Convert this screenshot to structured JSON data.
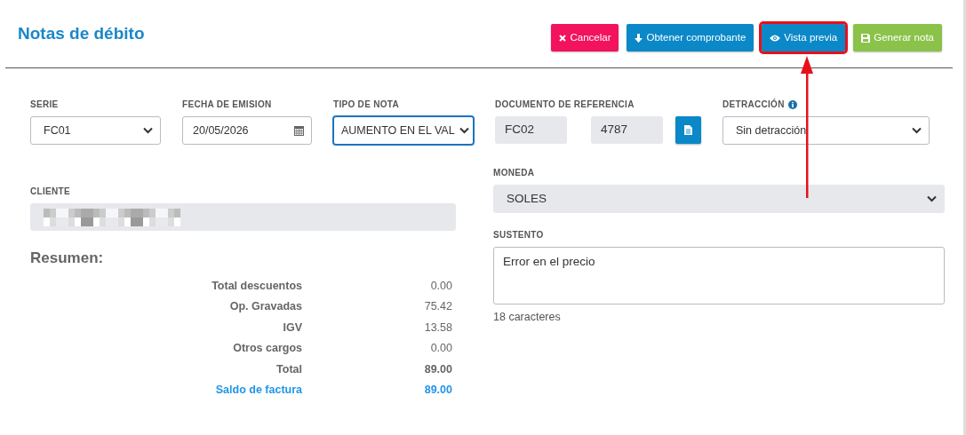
{
  "page_title": "Notas de débito",
  "actions": [
    {
      "label": "Cancelar",
      "kind": "cancel",
      "highlighted": false
    },
    {
      "label": "Obtener comprobante",
      "kind": "fetch",
      "highlighted": false
    },
    {
      "label": "Vista previa",
      "kind": "preview",
      "highlighted": true
    },
    {
      "label": "Generar nota",
      "kind": "save",
      "highlighted": false
    }
  ],
  "fields": [
    {
      "label": "SERIE",
      "kind": "select",
      "value": "FC01",
      "focused": false
    },
    {
      "label": "FECHA DE EMISION",
      "kind": "date",
      "value": "20/05/2026",
      "focused": false
    },
    {
      "label": "TIPO DE NOTA",
      "kind": "select",
      "value": "AUMENTO EN EL VAL",
      "focused": true
    },
    {
      "label": "DOCUMENTO DE REFERENCIA",
      "kind": "reference",
      "series": "FC02",
      "number": "4787"
    },
    {
      "label": "DETRACCIÓN",
      "kind": "select",
      "value": "Sin detracción",
      "info": true,
      "focused": false
    }
  ],
  "cliente": {
    "label": "CLIENTE",
    "disabled": true
  },
  "moneda": {
    "label": "MONEDA",
    "value": "SOLES",
    "disabled": true
  },
  "sustento": {
    "label": "SUSTENTO",
    "value": "Error en el precio",
    "counter": "18 caracteres"
  },
  "summary": {
    "title": "Resumen:",
    "rows": [
      {
        "label": "Total descuentos",
        "value": "0.00",
        "kind": "normal"
      },
      {
        "label": "Op. Gravadas",
        "value": "75.42",
        "kind": "normal"
      },
      {
        "label": "IGV",
        "value": "13.58",
        "kind": "normal"
      },
      {
        "label": "Otros cargos",
        "value": "0.00",
        "kind": "normal"
      },
      {
        "label": "Total",
        "value": "89.00",
        "kind": "total"
      },
      {
        "label": "Saldo de factura",
        "value": "89.00",
        "kind": "balance"
      }
    ]
  }
}
